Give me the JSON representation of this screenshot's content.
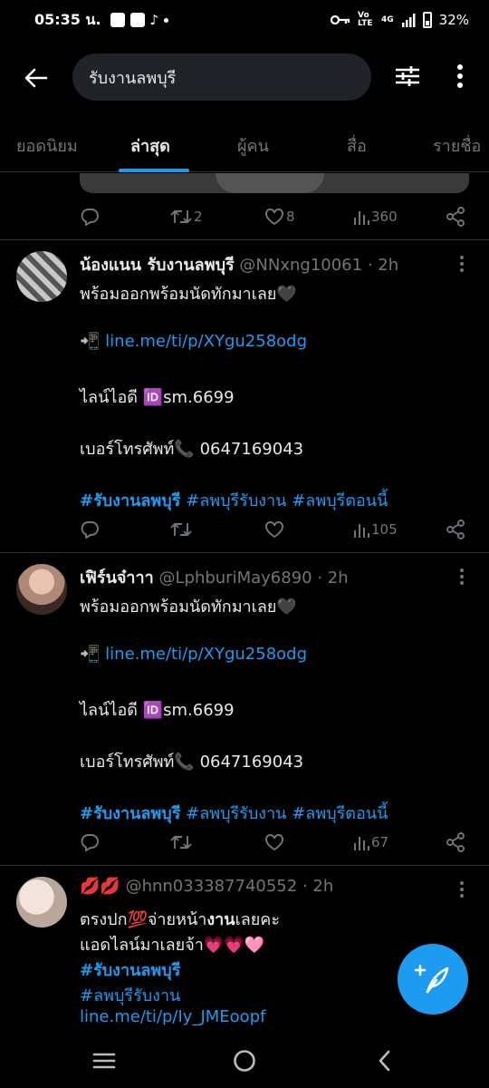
{
  "status": {
    "time": "05:35 น.",
    "network": "4G",
    "volte": "Vo LTE",
    "battery": "32%"
  },
  "search": {
    "query": "รับงานลพบุรี"
  },
  "tabs": [
    {
      "label": "ยอดนิยม"
    },
    {
      "label": "ล่าสุด",
      "active": true
    },
    {
      "label": "ผู้คน"
    },
    {
      "label": "สื่อ"
    },
    {
      "label": "รายชื่อ"
    }
  ],
  "prev_tweet": {
    "retweets": "2",
    "likes": "8",
    "views": "360"
  },
  "tweets": [
    {
      "name": "น้องแนน รับงานลพบุรี",
      "handle": "@NNxng10061",
      "time": "· 2h",
      "line1": "พร้อมออกพร้อมนัดทักมาเลย🖤",
      "link": "line.me/ti/p/XYgu258odg",
      "link_emoji": "📲",
      "lineid_label": "ไลน์ไอดี",
      "lineid_emoji": "🆔",
      "lineid": "sm.6699",
      "phone_label": "เบอร์โทรศัพท์",
      "phone_emoji": "📞",
      "phone": "0647169043",
      "tags": [
        "#รับงานลพบุรี",
        "#ลพบุรีรับงาน",
        "#ลพบุรีตอนนี้"
      ],
      "views": "105"
    },
    {
      "name": "เฟิร์นจ๋าาา",
      "handle": "@LphburiMay6890",
      "time": "· 2h",
      "line1": "พร้อมออกพร้อมนัดทักมาเลย🖤",
      "link": "line.me/ti/p/XYgu258odg",
      "link_emoji": "📲",
      "lineid_label": "ไลน์ไอดี",
      "lineid_emoji": "🆔",
      "lineid": "sm.6699",
      "phone_label": "เบอร์โทรศัพท์",
      "phone_emoji": "📞",
      "phone": "0647169043",
      "tags": [
        "#รับงานลพบุรี",
        "#ลพบุรีรับงาน",
        "#ลพบุรีตอนนี้"
      ],
      "views": "67"
    },
    {
      "name": "💋💋",
      "handle": "@hnn033387740552",
      "time": "· 2h",
      "line1_pre": "ตรงปก💯จ่ายหน้า",
      "line1_bold": "งาน",
      "line1_post": "เลยคะ",
      "line2": "แอดไลน์มาเลยจ้า💗💗🩷",
      "tag1": "#รับงานลพบุรี",
      "tag2": "#ลพบุรีรับงาน",
      "link": "line.me/ti/p/Iy_JMEoopf"
    }
  ],
  "colors": {
    "accent": "#1d9bf0",
    "muted": "#71767b",
    "background": "#000000",
    "text": "#e7e9ea"
  }
}
